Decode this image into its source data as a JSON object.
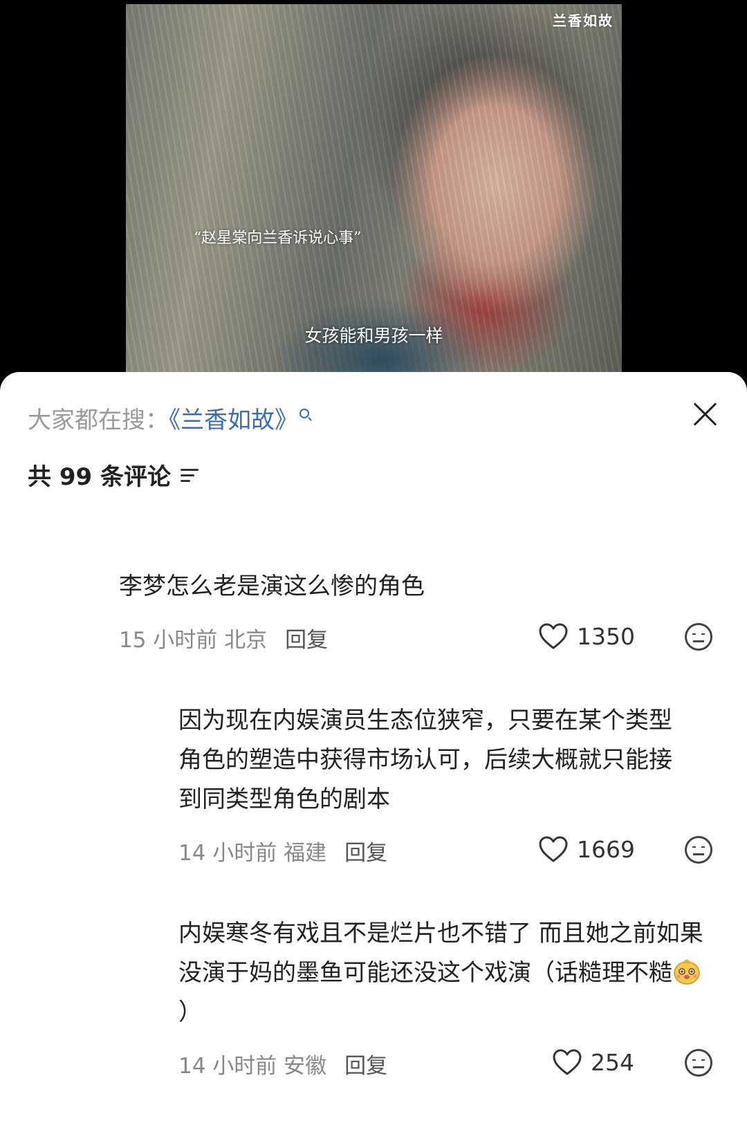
{
  "video": {
    "watermark": "兰香如故",
    "caption_top": "“赵星棠向兰香诉说心事”",
    "subtitle": "女孩能和男孩一样"
  },
  "sheet": {
    "search_prefix": "大家都在搜：",
    "search_term": "《兰香如故》",
    "comment_count_label": "共 99 条评论"
  },
  "comments": [
    {
      "text": "李梦怎么老是演这么惨的角色",
      "time_location": "15 小时前  北京",
      "reply": "回复",
      "likes": "1350"
    },
    {
      "text": "因为现在内娱演员生态位狭窄，只要在某个类型角色的塑造中获得市场认可，后续大概就只能接到同类型角色的剧本",
      "time_location": "14 小时前  福建",
      "reply": "回复",
      "likes": "1669"
    },
    {
      "text_a": "内娱寒冬有戏且不是烂片也不错了 而且她之前如果没演于妈的墨鱼可能还没这个戏演（话糙理不糙",
      "text_b": "）",
      "time_location": "14 小时前  安徽",
      "reply": "回复",
      "likes": "254"
    }
  ],
  "icons": {
    "heart": "heart-icon",
    "emoji": "emoji-face-icon",
    "close": "close-icon",
    "sort": "sort-icon",
    "search": "search-icon",
    "sticker": "dog-sticker-icon"
  }
}
